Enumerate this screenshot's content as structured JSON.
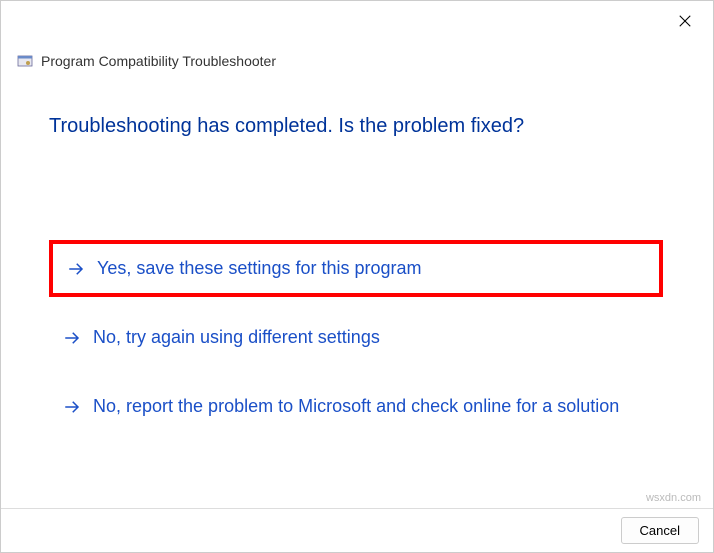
{
  "window": {
    "title": "Program Compatibility Troubleshooter"
  },
  "heading": "Troubleshooting has completed.  Is the problem fixed?",
  "options": {
    "yes": "Yes, save these settings for this program",
    "no_retry": "No, try again using different settings",
    "no_report": "No, report the problem to Microsoft and check online for a solution"
  },
  "footer": {
    "cancel_label": "Cancel"
  },
  "watermark": "wsxdn.com"
}
